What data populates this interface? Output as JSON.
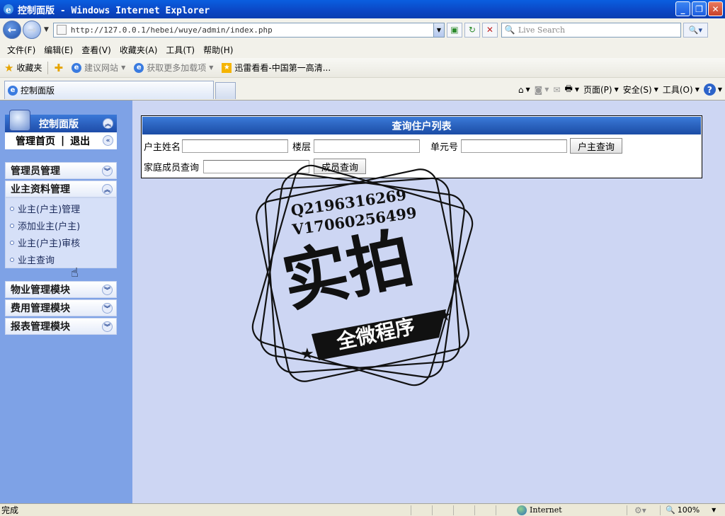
{
  "window": {
    "title": "控制面版 - Windows Internet Explorer"
  },
  "address": {
    "url": "http://127.0.0.1/hebei/wuye/admin/index.php"
  },
  "search": {
    "placeholder": "Live Search"
  },
  "menu": [
    "文件(F)",
    "编辑(E)",
    "查看(V)",
    "收藏夹(A)",
    "工具(T)",
    "帮助(H)"
  ],
  "favorites": {
    "label": "收藏夹",
    "items": [
      "建议网站",
      "获取更多加载项",
      "迅雷看看-中国第一高清..."
    ]
  },
  "tab": {
    "title": "控制面版"
  },
  "commandbar": {
    "page": "页面(P)",
    "safety": "安全(S)",
    "tools": "工具(O)"
  },
  "sidebar": {
    "panel_title": "控制面版",
    "home": "管理首页",
    "sep": "|",
    "logout": "退出",
    "sections": [
      "管理员管理",
      "业主资料管理",
      "物业管理模块",
      "费用管理模块",
      "报表管理模块"
    ],
    "owner_items": [
      "业主(户主)管理",
      "添加业主(户主)",
      "业主(户主)审核",
      "业主查询"
    ]
  },
  "query": {
    "title": "查询住户列表",
    "owner_name_label": "户主姓名",
    "floor_label": "楼层",
    "unit_label": "单元号",
    "owner_button": "户主查询",
    "family_label": "家庭成员查询",
    "family_button": "成员查询"
  },
  "watermark": {
    "qq": "Q2196316269",
    "wechat": "V17060256499",
    "main": "实拍",
    "banner": "全微程序"
  },
  "status": {
    "text": "完成",
    "zone": "Internet",
    "zoom": "100%"
  }
}
